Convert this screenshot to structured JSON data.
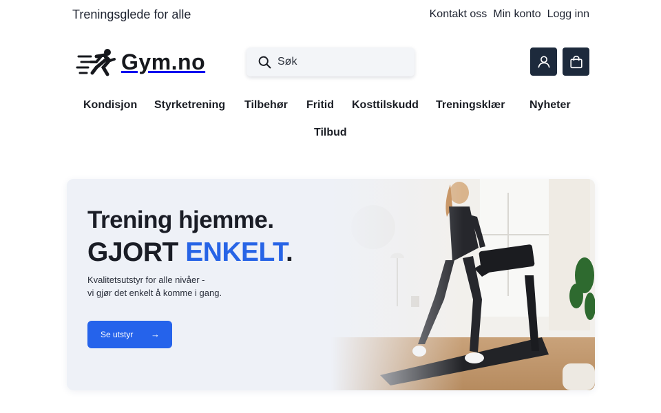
{
  "topbar": {
    "tagline": "Treningsglede for alle",
    "links": [
      "Kontakt oss",
      "Min konto",
      "Logg inn"
    ]
  },
  "header": {
    "logo_text": "Gym.no",
    "search": {
      "placeholder": "Søk",
      "value": ""
    },
    "icons": [
      "account-icon",
      "shopping-bag-icon"
    ]
  },
  "nav": {
    "items": [
      "Kondisjon",
      "Styrketrening",
      "Tilbehør",
      "Fritid",
      "Kosttilskudd",
      "Treningsklær",
      "Nyheter",
      "Tilbud"
    ]
  },
  "hero": {
    "title_line1": "Trening hjemme.",
    "title_line2_prefix": "GJORT ",
    "title_line2_accent": "ENKELT",
    "title_line2_suffix": ".",
    "subtitle_line1": "Kvalitetsutstyr for alle nivåer -",
    "subtitle_line2": "vi gjør det enkelt å komme i gang.",
    "cta_label": "Se utstyr",
    "cta_arrow": "→"
  },
  "colors": {
    "accent": "#2563eb",
    "dark_button": "#1d2a3c",
    "hero_background": "#eef1f7"
  }
}
